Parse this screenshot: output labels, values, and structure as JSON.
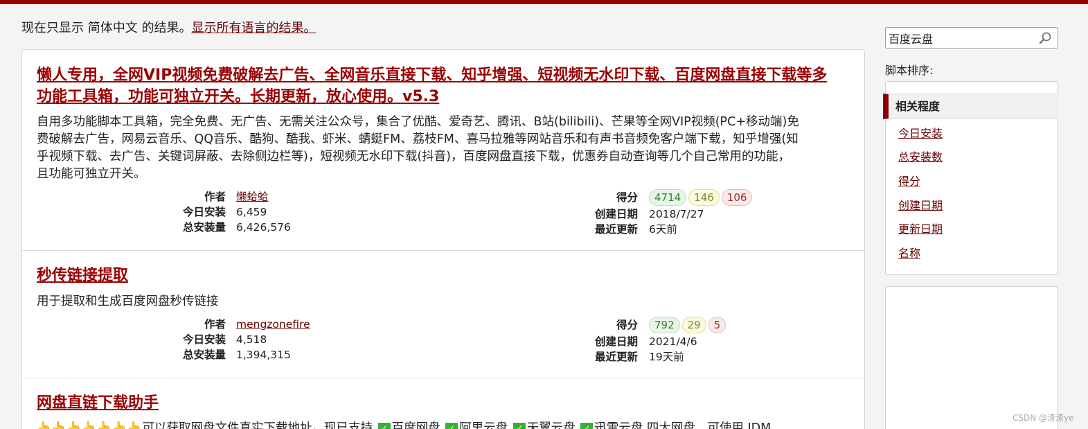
{
  "lang_notice": {
    "prefix": "现在只显示 简体中文 的结果。",
    "link": "显示所有语言的结果。"
  },
  "search": {
    "value": "百度云盘",
    "icon": "search-icon"
  },
  "sort": {
    "label": "脚本排序:",
    "active": "相关程度",
    "options": [
      "今日安装",
      "总安装数",
      "得分",
      "创建日期",
      "更新日期",
      "名称"
    ]
  },
  "labels": {
    "author": "作者",
    "daily": "今日安装",
    "total": "总安装量",
    "rating": "得分",
    "created": "创建日期",
    "updated": "最近更新"
  },
  "scripts": [
    {
      "title_line1": "懒人专用，全网VIP视频免费破解去广告、全网音乐直接下载、知乎增强、短视频无水印下载、百度网盘直接下载等多",
      "title_line2": "功能工具箱，功能可独立开关。长期更新，放心使用。v5.3",
      "desc_lines": [
        "自用多功能脚本工具箱，完全免费、无广告、无需关注公众号，集合了优酷、爱奇艺、腾讯、B站(bilibili)、芒果等全网VIP视频(PC+移动端)免",
        "费破解去广告，网易云音乐、QQ音乐、酷狗、酷我、虾米、蜻蜓FM、荔枝FM、喜马拉雅等网站音乐和有声书音频免客户端下载，知乎增强(知",
        "乎视频下载、去广告、关键词屏蔽、去除侧边栏等)，短视频无水印下载(抖音)，百度网盘直接下载，优惠券自动查询等几个自己常用的功能，",
        "且功能可独立开关。"
      ],
      "author": "懒蛤蛤",
      "daily": "6,459",
      "total": "6,426,576",
      "rating_good": "4714",
      "rating_ok": "146",
      "rating_bad": "106",
      "created": "2018/7/27",
      "updated": "6天前"
    },
    {
      "title_line1": "秒传链接提取",
      "desc_lines": [
        "用于提取和生成百度网盘秒传链接"
      ],
      "author": "mengzonefire",
      "daily": "4,518",
      "total": "1,394,315",
      "rating_good": "792",
      "rating_ok": "29",
      "rating_bad": "5",
      "created": "2021/4/6",
      "updated": "19天前"
    },
    {
      "title_line1": "网盘直链下载助手",
      "desc_partial": {
        "hands": "👆👆👆👆👆👆👆",
        "text1": "可以获取网盘文件真实下载地址。现已支持",
        "items": [
          "百度网盘",
          "阿里云盘",
          "天翼云盘",
          "迅雷云盘"
        ],
        "text2": "四大网盘，可使用 IDM"
      }
    }
  ],
  "watermark": "CSDN @渣渣ye",
  "colors": {
    "accent": "#990000",
    "link": "#670000",
    "sort_marker": "#8b0000"
  }
}
